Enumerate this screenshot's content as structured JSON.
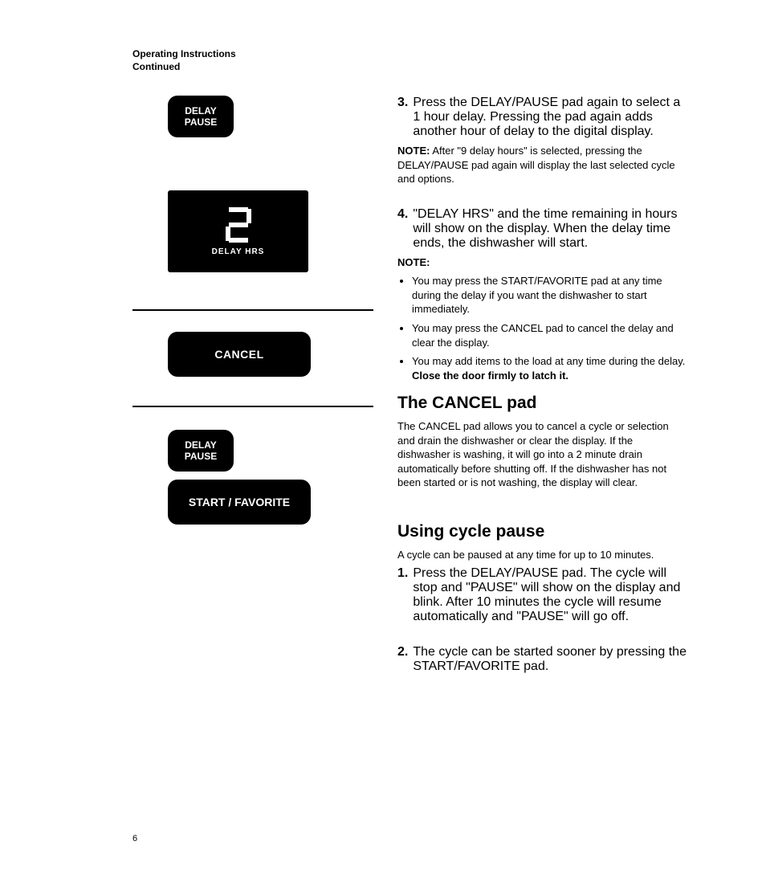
{
  "header": {
    "line1": "Operating Instructions",
    "line2": "Continued"
  },
  "buttons": {
    "delay_pause_line1": "DELAY",
    "delay_pause_line2": "PAUSE",
    "cancel": "CANCEL",
    "start_favorite": "START / FAVORITE"
  },
  "display": {
    "label": "DELAY  HRS",
    "value": "2"
  },
  "right": {
    "step3_num": "3.",
    "step3_text": "Press the DELAY/PAUSE pad again to select a 1 hour delay. Pressing the pad again adds another hour of delay to the digital display.",
    "note1_label": "NOTE:",
    "note1_text": " After \"9 delay hours\" is selected, pressing the DELAY/PAUSE pad again will display the last selected cycle and options.",
    "step4_num": "4.",
    "step4_text": "\"DELAY HRS\" and the time remaining in hours will show on the display. When the delay time ends, the dishwasher will start.",
    "note2_label": "NOTE:",
    "bullets": [
      "You may press the START/FAVORITE pad at any time during the delay if you want the dishwasher to start immediately.",
      "You may press the CANCEL pad to cancel the delay and clear the display."
    ],
    "bullet3_a": "You may add items to the load at any time during the delay. ",
    "bullet3_b": "Close the door firmly to latch it.",
    "cancel_title_a": "The ",
    "cancel_title_b": "CANCEL",
    "cancel_title_c": " pad",
    "cancel_para": "The CANCEL pad allows you to cancel a cycle or selection and drain the dishwasher or clear the display. If the dishwasher is washing, it will go into a 2 minute drain automatically before shutting off. If the dishwasher has not been started or is not washing, the display will clear.",
    "pause_title": "Using cycle pause",
    "pause_intro": "A cycle can be paused at any time for up to 10 minutes.",
    "pstep1_num": "1.",
    "pstep1_text": "Press the DELAY/PAUSE pad. The cycle will stop and \"PAUSE\" will show on the display and blink. After 10 minutes the cycle will resume automatically and \"PAUSE\" will go off.",
    "pstep2_num": "2.",
    "pstep2_text": "The cycle can be started sooner by pressing the START/FAVORITE pad."
  },
  "page_number": "6"
}
